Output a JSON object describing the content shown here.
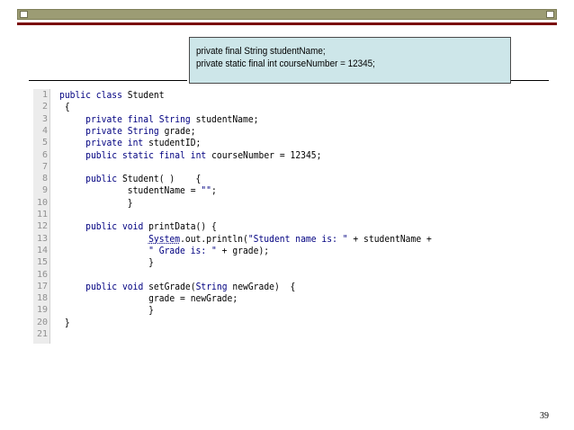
{
  "callout": {
    "lines": [
      "private final String studentName;",
      "private static final int courseNumber = 12345;"
    ]
  },
  "code": {
    "lines": [
      {
        "number": "1",
        "text": "public class Student"
      },
      {
        "number": "2",
        "text": " {"
      },
      {
        "number": "3",
        "text": "     private final String studentName;"
      },
      {
        "number": "4",
        "text": "     private String grade;"
      },
      {
        "number": "5",
        "text": "     private int studentID;"
      },
      {
        "number": "6",
        "text": "     public static final int courseNumber = 12345;"
      },
      {
        "number": "7",
        "text": ""
      },
      {
        "number": "8",
        "text": "     public Student( )    {"
      },
      {
        "number": "9",
        "text": "             studentName = \"\";"
      },
      {
        "number": "10",
        "text": "             }"
      },
      {
        "number": "11",
        "text": ""
      },
      {
        "number": "12",
        "text": "     public void printData() {"
      },
      {
        "number": "13",
        "text": "                 System.out.println(\"Student name is: \" + studentName +"
      },
      {
        "number": "14",
        "text": "                 \" Grade is: \" + grade);"
      },
      {
        "number": "15",
        "text": "                 }"
      },
      {
        "number": "16",
        "text": ""
      },
      {
        "number": "17",
        "text": "     public void setGrade(String newGrade)  {"
      },
      {
        "number": "18",
        "text": "                 grade = newGrade;"
      },
      {
        "number": "19",
        "text": "                 }"
      },
      {
        "number": "20",
        "text": " }"
      },
      {
        "number": "21",
        "text": ""
      }
    ],
    "colors": {
      "keyword": "#000080",
      "string": "#000080",
      "line_number": "#909090",
      "gutter": "#ececec"
    }
  },
  "footer": {
    "page_number": "39"
  },
  "theme": {
    "top_bar": "#9c9c74",
    "top_rule": "#7a0000",
    "callout_background": "#cde6e9"
  }
}
